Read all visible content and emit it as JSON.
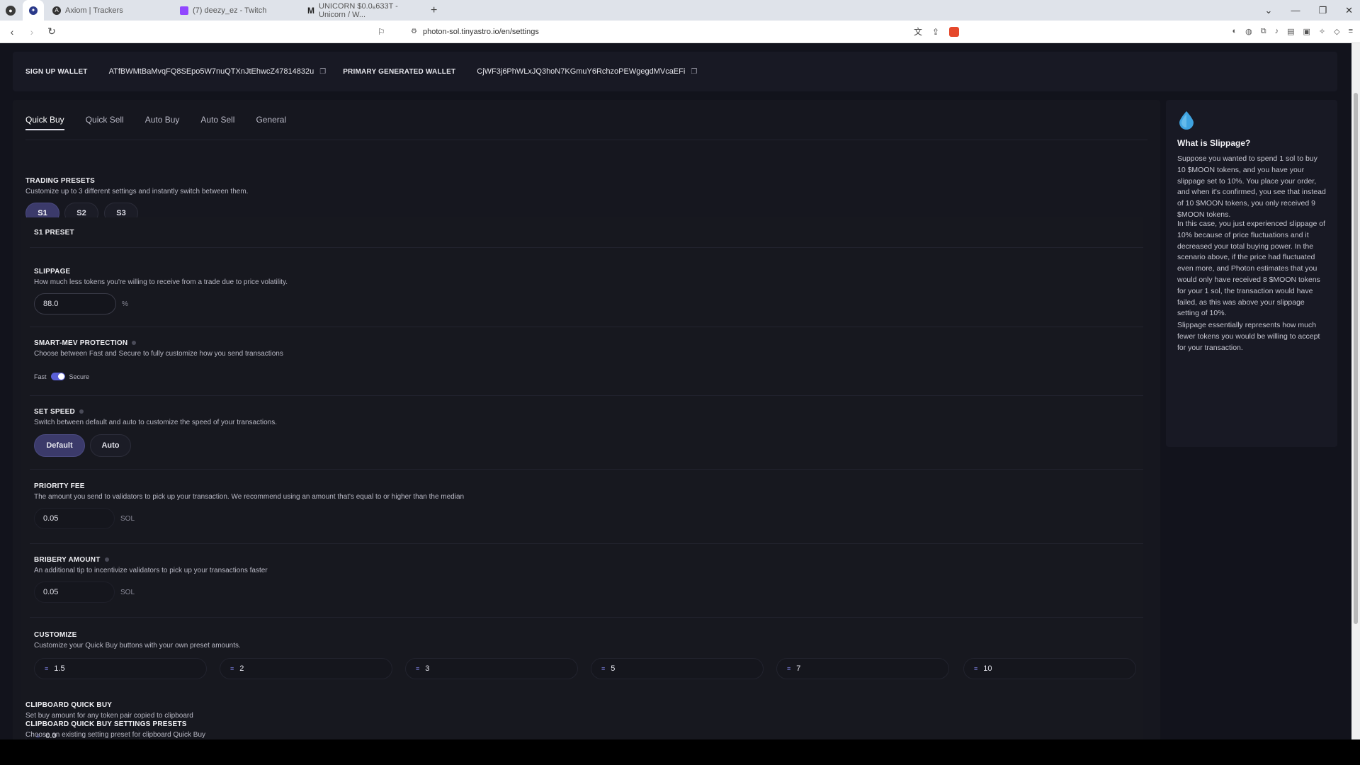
{
  "browser": {
    "tabs": [
      {
        "label": "Axiom | Trackers"
      },
      {
        "label": "(7) deezy_ez - Twitch"
      },
      {
        "label": "UNICORN $0.0₆633T - Unicorn / W..."
      }
    ],
    "url": "photon-sol.tinyastro.io/en/settings"
  },
  "wallets": {
    "signup_label": "SIGN UP WALLET",
    "signup_address": "ATfBWMtBaMvqFQ8SEpo5W7nuQTXnJtEhwcZ47814832u",
    "primary_label": "PRIMARY GENERATED WALLET",
    "primary_address": "CjWF3j6PhWLxJQ3hoN7KGmuY6RchzoPEWgegdMVcaEFi"
  },
  "settings_tabs": [
    {
      "label": "Quick Buy"
    },
    {
      "label": "Quick Sell"
    },
    {
      "label": "Auto Buy"
    },
    {
      "label": "Auto Sell"
    },
    {
      "label": "General"
    }
  ],
  "trading_presets": {
    "title": "TRADING PRESETS",
    "desc": "Customize up to 3 different settings and instantly switch between them.",
    "presets": [
      "S1",
      "S2",
      "S3"
    ],
    "preset_heading": "S1 PRESET"
  },
  "slippage": {
    "title": "SLIPPAGE",
    "desc": "How much less tokens you're willing to receive from a trade due to price volatility.",
    "value": "88.0",
    "unit": "%"
  },
  "mev": {
    "title": "SMART-MEV PROTECTION",
    "desc": "Choose between Fast and Secure to fully customize how you send transactions",
    "fast_label": "Fast",
    "secure_label": "Secure"
  },
  "speed": {
    "title": "SET SPEED",
    "desc": "Switch between default and auto to customize the speed of your transactions.",
    "default_label": "Default",
    "auto_label": "Auto"
  },
  "priority_fee": {
    "title": "PRIORITY FEE",
    "desc": "The amount you send to validators to pick up your transaction. We recommend using an amount that's equal to or higher than the median",
    "value": "0.05",
    "unit": "SOL"
  },
  "bribery": {
    "title": "BRIBERY AMOUNT",
    "desc": "An additional tip to incentivize validators to pick up your transactions faster",
    "value": "0.05",
    "unit": "SOL"
  },
  "customize": {
    "title": "CUSTOMIZE",
    "desc": "Customize your Quick Buy buttons with your own preset amounts.",
    "amounts": [
      "1.5",
      "2",
      "3",
      "5",
      "7",
      "10"
    ]
  },
  "clipboard": {
    "title": "CLIPBOARD QUICK BUY",
    "desc": "Set buy amount for any token pair copied to clipboard",
    "value": "0.0",
    "presets_title": "CLIPBOARD QUICK BUY SETTINGS PRESETS",
    "presets_desc": "Choose an existing setting preset for clipboard Quick Buy"
  },
  "sidebar": {
    "title": "What is Slippage?",
    "p1": "Suppose you wanted to spend 1 sol to buy 10 $MOON tokens, and you have your slippage set to 10%. You place your order, and when it's confirmed, you see that instead of 10 $MOON tokens, you only received 9 $MOON tokens.",
    "p2": "In this case, you just experienced slippage of 10% because of price fluctuations and it decreased your total buying power. In the scenario above, if the price had fluctuated even more, and Photon estimates that you would only have received 8 $MOON tokens for your 1 sol, the transaction would have failed, as this was above your slippage setting of 10%.",
    "p3": "Slippage essentially represents how much fewer tokens you would be willing to accept for your transaction."
  }
}
